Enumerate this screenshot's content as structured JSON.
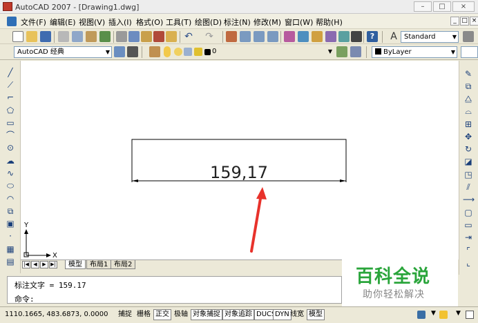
{
  "window": {
    "title": "AutoCAD 2007 - [Drawing1.dwg]",
    "controls": [
      "–",
      "□",
      "×"
    ]
  },
  "menu": {
    "items": [
      "文件(F)",
      "编辑(E)",
      "视图(V)",
      "插入(I)",
      "格式(O)",
      "工具(T)",
      "绘图(D)",
      "标注(N)",
      "修改(M)",
      "窗口(W)",
      "帮助(H)"
    ],
    "mdi_controls": [
      "_",
      "□",
      "×"
    ]
  },
  "toolbar1": {
    "text_style": "Standard"
  },
  "toolbar2": {
    "workspace": "AutoCAD 经典",
    "layer": "0",
    "color": "ByLayer"
  },
  "drawing": {
    "dimension_text": "159,17",
    "ucs_x": "X",
    "ucs_y": "Y"
  },
  "tabs": {
    "items": [
      "模型",
      "布局1",
      "布局2"
    ]
  },
  "command": {
    "line1": "标注文字 = 159.17",
    "line2": "命令:"
  },
  "status": {
    "coords": "1110.1665, 483.6873, 0.0000",
    "toggles": [
      "捕捉",
      "栅格",
      "正交",
      "极轴",
      "对象捕捉",
      "对象追踪",
      "DUCS",
      "DYN",
      "线宽",
      "模型"
    ]
  },
  "watermark": {
    "title": "百科全说",
    "subtitle": "助你轻松解决"
  },
  "colors": {
    "annotation_arrow": "#e8322b",
    "watermark_green": "#2aa53b"
  }
}
